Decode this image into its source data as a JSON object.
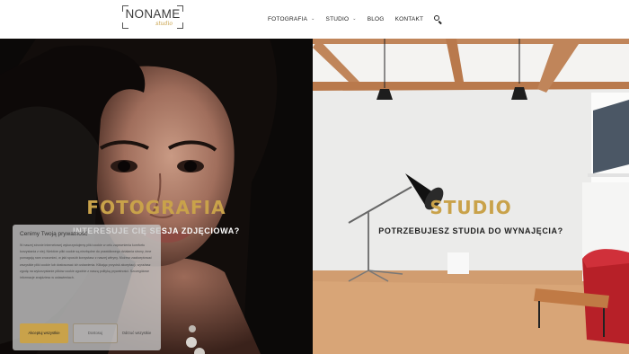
{
  "header": {
    "logo_text": "NONAME",
    "logo_sub": "studio",
    "nav": [
      {
        "label": "FOTOGRAFIA",
        "has_dropdown": true
      },
      {
        "label": "STUDIO",
        "has_dropdown": true
      },
      {
        "label": "BLOG",
        "has_dropdown": false
      },
      {
        "label": "KONTAKT",
        "has_dropdown": false
      }
    ],
    "search_icon": "search-icon"
  },
  "hero": {
    "left": {
      "title": "FOTOGRAFIA",
      "subtitle": "INTERESUJE CIĘ SESJA ZDJĘCIOWA?"
    },
    "right": {
      "title": "STUDIO",
      "subtitle": "POTRZEBUJESZ STUDIA DO WYNAJĘCIA?"
    }
  },
  "cookie": {
    "title": "Cenimy Twoją prywatność",
    "text": "W naszej stronie internetowej wykorzystujemy pliki cookie w celu zapewnienia komfortu korzystania z niej. Niektóre pliki cookie są niezbędne do prawidłowego działania strony, inne pomagają nam zrozumieć, w jaki sposób korzystasz z naszej witryny. Możesz zaakceptować wszystkie pliki cookie lub dostosować ich ustawienia. Klikając przycisk akceptacji, wyrażasz zgodę na wykorzystanie plików cookie zgodnie z naszą polityką prywatności. Szczegółowe informacje znajdziesz w ustawieniach.",
    "accept_label": "Akceptuj wszystkie",
    "settings_label": "Dostosuj",
    "reject_label": "Odrzuć wszystkie"
  },
  "colors": {
    "accent_gold": "#c9a24a",
    "nav_text": "#222222"
  }
}
